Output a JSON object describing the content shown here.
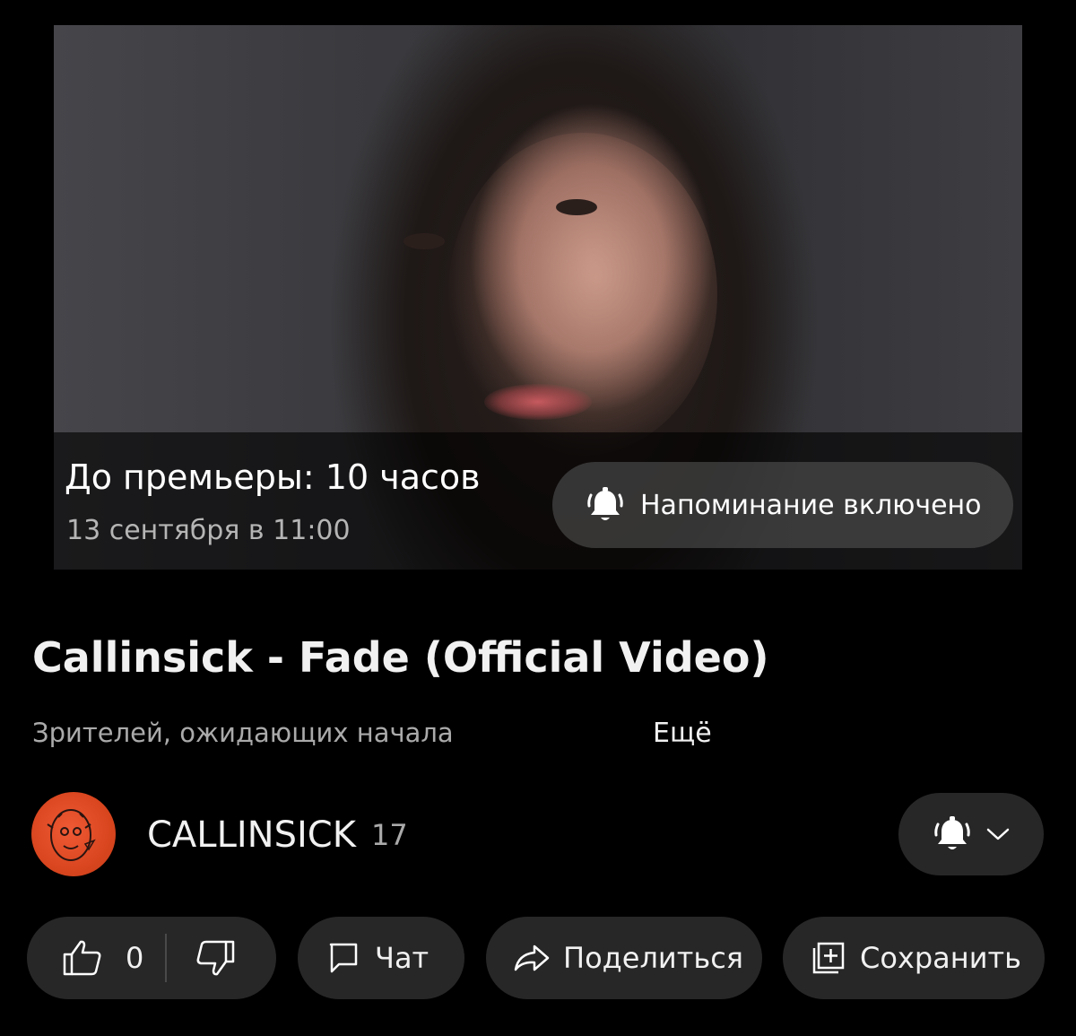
{
  "video": {
    "premiere_countdown": "До премьеры: 10 часов",
    "premiere_date": "13 сентября в 11:00",
    "reminder_label": "Напоминание включено"
  },
  "details": {
    "title": "Callinsick - Fade (Official Video)",
    "viewers_label": "Зрителей, ожидающих начала",
    "more_label": "Ещё"
  },
  "channel": {
    "name": "CALLINSICK",
    "subscribers": "17",
    "avatar_color": "#e14b25",
    "bell_icon": "bell-filled-icon",
    "dropdown_icon": "chevron-down-icon"
  },
  "actions": {
    "like_count": "0",
    "chat_label": "Чат",
    "share_label": "Поделиться",
    "save_label": "Сохранить"
  }
}
